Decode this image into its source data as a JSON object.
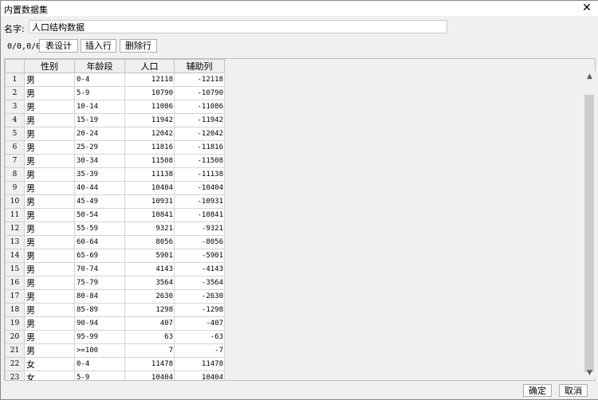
{
  "window": {
    "title": "内置数据集",
    "close_glyph": "✕"
  },
  "name_row": {
    "label": "名字:",
    "value": "人口结构数据"
  },
  "toolbar": {
    "coords": "0/0,0/0",
    "table_design": "表设计",
    "insert_row": "插入行",
    "delete_row": "删除行"
  },
  "grid": {
    "columns": [
      "性别",
      "年龄段",
      "人口",
      "辅助列"
    ],
    "rows": [
      [
        "1",
        "男",
        "0-4",
        "12118",
        "-12118"
      ],
      [
        "2",
        "男",
        "5-9",
        "10790",
        "-10790"
      ],
      [
        "3",
        "男",
        "10-14",
        "11086",
        "-11086"
      ],
      [
        "4",
        "男",
        "15-19",
        "11942",
        "-11942"
      ],
      [
        "5",
        "男",
        "20-24",
        "12042",
        "-12042"
      ],
      [
        "6",
        "男",
        "25-29",
        "11816",
        "-11816"
      ],
      [
        "7",
        "男",
        "30-34",
        "11508",
        "-11508"
      ],
      [
        "8",
        "男",
        "35-39",
        "11138",
        "-11138"
      ],
      [
        "9",
        "男",
        "40-44",
        "10404",
        "-10404"
      ],
      [
        "10",
        "男",
        "45-49",
        "10931",
        "-10931"
      ],
      [
        "11",
        "男",
        "50-54",
        "10841",
        "-10841"
      ],
      [
        "12",
        "男",
        "55-59",
        "9321",
        "-9321"
      ],
      [
        "13",
        "男",
        "60-64",
        "8056",
        "-8056"
      ],
      [
        "14",
        "男",
        "65-69",
        "5901",
        "-5901"
      ],
      [
        "15",
        "男",
        "70-74",
        "4143",
        "-4143"
      ],
      [
        "16",
        "男",
        "75-79",
        "3564",
        "-3564"
      ],
      [
        "17",
        "男",
        "80-84",
        "2630",
        "-2630"
      ],
      [
        "18",
        "男",
        "85-89",
        "1298",
        "-1298"
      ],
      [
        "19",
        "男",
        "90-94",
        "407",
        "-407"
      ],
      [
        "20",
        "男",
        "95-99",
        "63",
        "-63"
      ],
      [
        "21",
        "男",
        ">=100",
        "7",
        "-7"
      ],
      [
        "22",
        "女",
        "0-4",
        "11478",
        "11478"
      ],
      [
        "23",
        "女",
        "5-9",
        "10404",
        "10404"
      ]
    ]
  },
  "scrollbar": {
    "up_glyph": "▲",
    "down_glyph": "▼"
  },
  "footer": {
    "ok": "确定",
    "cancel": "取消"
  }
}
